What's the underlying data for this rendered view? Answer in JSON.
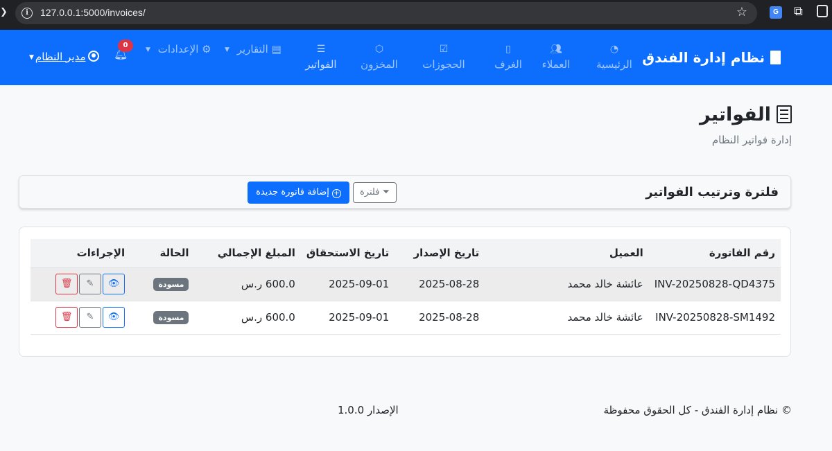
{
  "browser": {
    "url": "127.0.0.1:5000/invoices/"
  },
  "navbar": {
    "brand": "نظام إدارة الفندق",
    "items": [
      {
        "label": "الرئيسية",
        "icon": "speedometer-icon"
      },
      {
        "label": "العملاء",
        "icon": "people-icon"
      },
      {
        "label": "الغرف",
        "icon": "door-icon"
      },
      {
        "label": "الحجوزات",
        "icon": "calendar-check-icon"
      },
      {
        "label": "المخزون",
        "icon": "box-icon"
      },
      {
        "label": "الفواتير",
        "icon": "receipt-icon"
      }
    ],
    "reports": "التقارير",
    "settings": "الإعدادات",
    "notification_count": "0",
    "user": "مدير النظام"
  },
  "page": {
    "title": "الفواتير",
    "subtitle": "إدارة فواتير النظام"
  },
  "filter": {
    "title": "فلترة وترتيب الفواتير",
    "filter_button": "فلترة",
    "add_button": "إضافة فاتورة جديدة"
  },
  "table": {
    "headers": [
      "رقم الفاتورة",
      "العميل",
      "تاريخ الإصدار",
      "تاريخ الاستحقاق",
      "المبلغ الإجمالي",
      "الحالة",
      "الإجراءات"
    ],
    "rows": [
      {
        "number": "INV-20250828-QD4375",
        "client": "عائشة خالد محمد",
        "issue": "2025-08-28",
        "due": "2025-09-01",
        "amount": "600.0 ر.س",
        "status": "مسودة"
      },
      {
        "number": "INV-20250828-SM1492",
        "client": "عائشة خالد محمد",
        "issue": "2025-08-28",
        "due": "2025-09-01",
        "amount": "600.0 ر.س",
        "status": "مسودة"
      }
    ]
  },
  "footer": {
    "copyright": "© نظام إدارة الفندق - كل الحقوق محفوظة",
    "version": "الإصدار 1.0.0"
  },
  "colors": {
    "primary": "#0d6efd",
    "danger": "#dc3545",
    "secondary": "#6c757d"
  }
}
